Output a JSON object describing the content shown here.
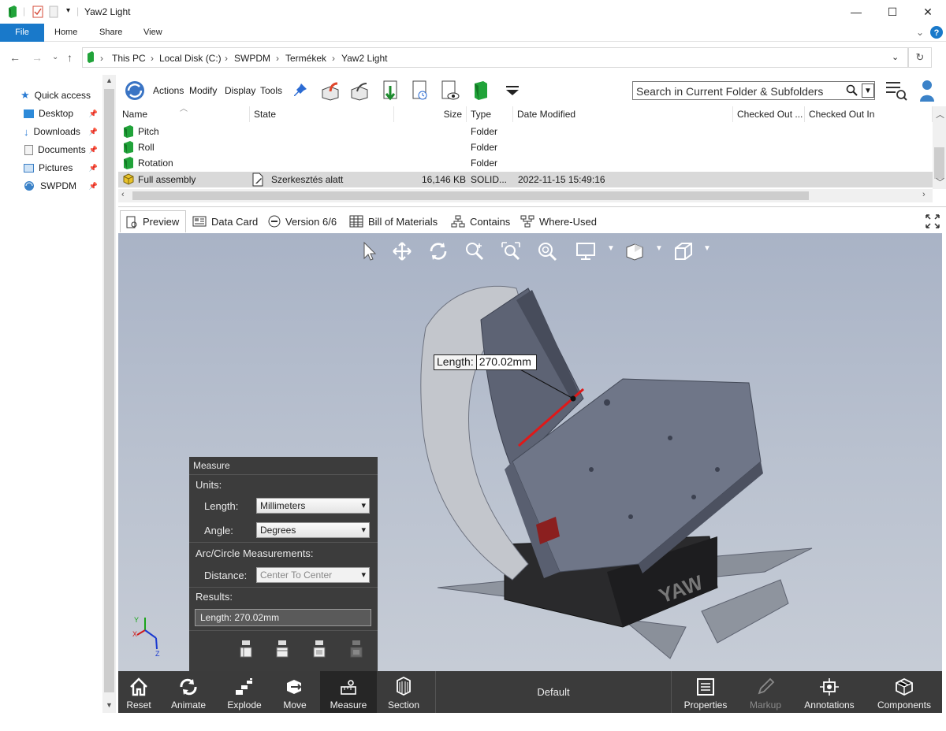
{
  "window": {
    "title": "Yaw2 Light"
  },
  "ribbon": {
    "tabs": [
      "File",
      "Home",
      "Share",
      "View"
    ]
  },
  "address": {
    "crumbs": [
      "This PC",
      "Local Disk (C:)",
      "SWPDM",
      "Termékek",
      "Yaw2 Light"
    ]
  },
  "nav": {
    "items": [
      {
        "label": "Quick access",
        "icon": "star-icon"
      },
      {
        "label": "Desktop",
        "icon": "desktop-icon"
      },
      {
        "label": "Downloads",
        "icon": "download-icon"
      },
      {
        "label": "Documents",
        "icon": "document-icon"
      },
      {
        "label": "Pictures",
        "icon": "pictures-icon"
      },
      {
        "label": "SWPDM",
        "icon": "vault-icon"
      }
    ]
  },
  "pdm": {
    "menus": [
      "Actions",
      "Modify",
      "Display",
      "Tools"
    ],
    "search_placeholder": "Search in Current Folder & Subfolders"
  },
  "files": {
    "columns": [
      "Name",
      "State",
      "Size",
      "Type",
      "Date Modified",
      "Checked Out ...",
      "Checked Out In"
    ],
    "rows": [
      {
        "name": "Pitch",
        "state": "",
        "size": "",
        "type": "Folder",
        "date": ""
      },
      {
        "name": "Roll",
        "state": "",
        "size": "",
        "type": "Folder",
        "date": ""
      },
      {
        "name": "Rotation",
        "state": "",
        "size": "",
        "type": "Folder",
        "date": ""
      },
      {
        "name": "Full assembly",
        "state": "Szerkesztés alatt",
        "size": "16,146 KB",
        "type": "SOLID...",
        "date": "2022-11-15 15:49:16"
      }
    ]
  },
  "view_tabs": [
    "Preview",
    "Data Card",
    "Version 6/6",
    "Bill of Materials",
    "Contains",
    "Where-Used"
  ],
  "measure": {
    "title": "Measure",
    "units_label": "Units:",
    "length_label": "Length:",
    "length_value": "Millimeters",
    "angle_label": "Angle:",
    "angle_value": "Degrees",
    "arc_label": "Arc/Circle Measurements:",
    "distance_label": "Distance:",
    "distance_value": "Center To Center",
    "results_label": "Results:",
    "result_value": "Length: 270.02mm"
  },
  "callout": {
    "key": "Length:",
    "value": "270.02mm"
  },
  "bottom": {
    "left": [
      "Reset",
      "Animate",
      "Explode",
      "Move",
      "Measure",
      "Section"
    ],
    "center": "Default",
    "right": [
      "Properties",
      "Markup",
      "Annotations",
      "Components"
    ]
  },
  "axes": {
    "y": "Y",
    "x": "X",
    "z": "Z"
  },
  "colors": {
    "accent": "#1979ca",
    "panel": "#3c3c3c",
    "measure_line": "#e01818"
  }
}
